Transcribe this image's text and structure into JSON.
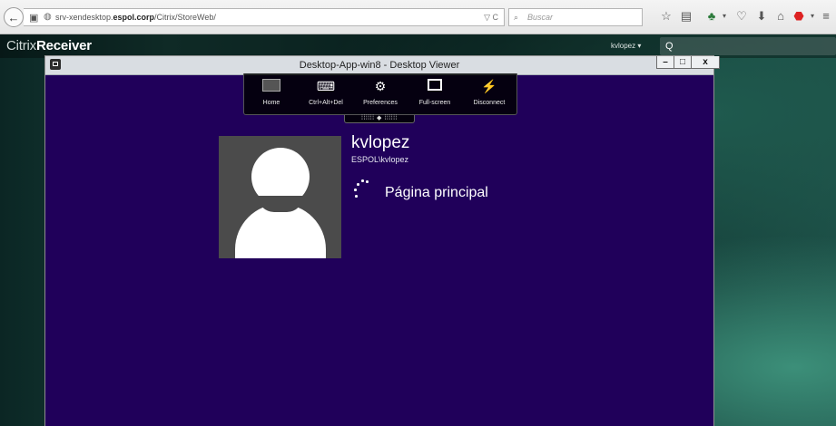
{
  "browser": {
    "url_prefix": "srv-xendesktop.",
    "url_domain": "espol.corp",
    "url_suffix": "/Citrix/StoreWeb/",
    "search_placeholder": "Buscar",
    "back_glyph": "←",
    "reload_glyph": "C",
    "dropdown_glyph": "▽",
    "icons": [
      "star-icon",
      "reading-list-icon",
      "download-icon",
      "home-icon",
      "adblock-icon",
      "menu-icon"
    ]
  },
  "citrix": {
    "brand_light": "Citrix",
    "brand_bold": "Receiver",
    "user_menu": "kvlopez ▾",
    "search_glyph": "Q"
  },
  "viewer": {
    "title": "Desktop-App-win8 - Desktop Viewer",
    "minimize": "–",
    "restore": "□",
    "close": "x",
    "toolbar": [
      {
        "label": "Home",
        "icon": "home-icon"
      },
      {
        "label": "Ctrl+Alt+Del",
        "icon": "keyboard-icon"
      },
      {
        "label": "Preferences",
        "icon": "gears-icon"
      },
      {
        "label": "Full-screen",
        "icon": "fullscreen-icon"
      },
      {
        "label": "Disconnect",
        "icon": "disconnect-icon"
      }
    ],
    "handle": "⁞⁞⁞⁞⁞⁞ ◆ ⁞⁞⁞⁞⁞⁞"
  },
  "session": {
    "username": "kvlopez",
    "domain_user": "ESPOL\\kvlopez",
    "status": "Página principal"
  },
  "colors": {
    "desktop_bg": "#20005a",
    "titlebar": "#d9dde2",
    "citrix_bg": "#17413b"
  }
}
